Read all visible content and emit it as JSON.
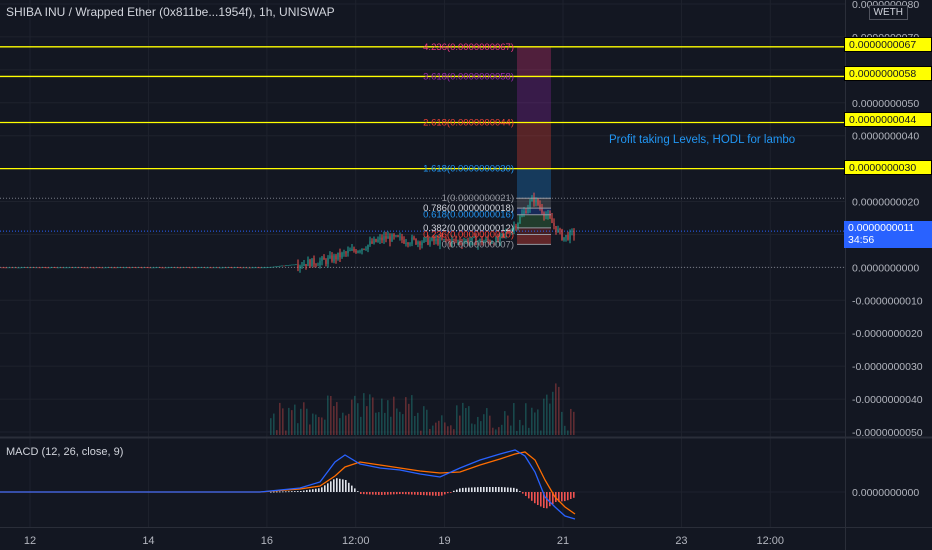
{
  "header": {
    "title": "SHIBA INU / Wrapped Ether (0x811be...1954f), 1h, UNISWAP",
    "currency": "WETH"
  },
  "price_axis": {
    "ticks": [
      "0.0000000080",
      "0.0000000070",
      "0.0000000060",
      "0.0000000050",
      "0.0000000040",
      "0.0000000030",
      "0.0000000020",
      "0.0000000010",
      "0.0000000000",
      "-0.0000000010",
      "-0.0000000020",
      "-0.0000000030",
      "-0.0000000040",
      "-0.0000000050"
    ],
    "macd_tick": "0.0000000000"
  },
  "time_axis": {
    "ticks": [
      "12",
      "14",
      "16",
      "12:00",
      "19",
      "21",
      "23",
      "12:00"
    ]
  },
  "price_labels": {
    "last_price": "0.0000000011",
    "countdown": "34:56",
    "levels": [
      "0.0000000067",
      "0.0000000058",
      "0.0000000044",
      "0.0000000030"
    ]
  },
  "annotation": "Profit taking Levels, HODL for lambo",
  "fib_labels": [
    {
      "text": "4.236(0.0000000067)",
      "color": "#f23682"
    },
    {
      "text": "3.618(0.0000000058)",
      "color": "#9c27b0"
    },
    {
      "text": "2.618(0.0000000044)",
      "color": "#f44336"
    },
    {
      "text": "1.618(0.0000000030)",
      "color": "#2196f3"
    },
    {
      "text": "1(0.0000000021)",
      "color": "#9598a1"
    },
    {
      "text": "0.786(0.0000000018)",
      "color": "#d1d4dc"
    },
    {
      "text": "0.618(0.0000000016)",
      "color": "#2196f3"
    },
    {
      "text": "0.382(0.0000000012)",
      "color": "#d1d4dc"
    },
    {
      "text": "0.236(0.0000000010)",
      "color": "#f44336"
    },
    {
      "text": "0(0.0000000007)",
      "color": "#9598a1"
    }
  ],
  "macd": {
    "title": "MACD (12, 26, close, 9)"
  },
  "chart_data": {
    "type": "line",
    "title": "SHIBA INU / Wrapped Ether (0x811be...1954f), 1h, UNISWAP",
    "x": [
      "11",
      "12",
      "13",
      "14",
      "15",
      "16",
      "17",
      "18",
      "18.5",
      "19",
      "20",
      "20.5",
      "21",
      "21.3"
    ],
    "series": [
      {
        "values": [
          0.0,
          0.0,
          0.0,
          0.0,
          0.0,
          0.0,
          2e-10,
          5e-10,
          8e-10,
          8e-10,
          8e-10,
          2.1e-09,
          9e-10,
          1.1e-09
        ]
      }
    ],
    "horizontal_levels": [
      6.7e-09,
      5.8e-09,
      4.4e-09,
      3e-09
    ],
    "fib_levels": [
      {
        "ratio": 4.236,
        "value": 6.7e-09
      },
      {
        "ratio": 3.618,
        "value": 5.8e-09
      },
      {
        "ratio": 2.618,
        "value": 4.4e-09
      },
      {
        "ratio": 1.618,
        "value": 3e-09
      },
      {
        "ratio": 1,
        "value": 2.1e-09
      },
      {
        "ratio": 0.786,
        "value": 1.8e-09
      },
      {
        "ratio": 0.618,
        "value": 1.6e-09
      },
      {
        "ratio": 0.382,
        "value": 1.2e-09
      },
      {
        "ratio": 0.236,
        "value": 1e-09
      },
      {
        "ratio": 0,
        "value": 7e-10
      }
    ],
    "last_price": 1.1e-09,
    "ylim": [
      -5e-09,
      8e-09
    ],
    "colors": {
      "background": "#131722",
      "up": "#26a69a",
      "down": "#ef5350",
      "level": "#ffff00",
      "macd": "#2962ff",
      "signal": "#ff6d00"
    }
  }
}
